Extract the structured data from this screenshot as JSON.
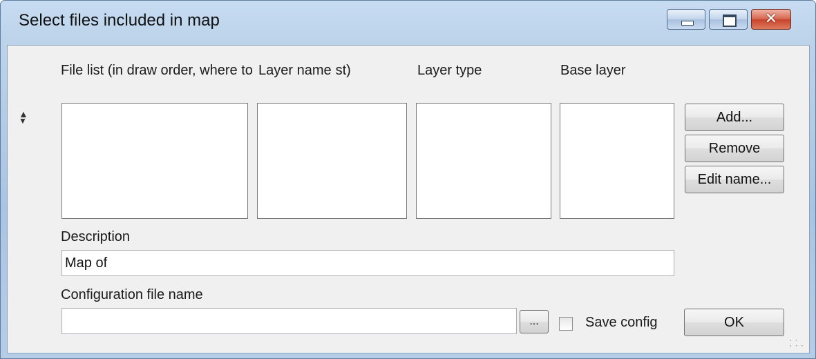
{
  "window": {
    "title": "Select files included in map",
    "controls": {
      "minimize": "minimize",
      "maximize": "maximize",
      "close": "close"
    }
  },
  "columns": {
    "file_list": "File list (in draw order, where to",
    "layer_name": "Layer name",
    "layer_name_tail": "st)",
    "layer_type": "Layer type",
    "base_layer": "Base layer"
  },
  "buttons": {
    "add": "Add...",
    "remove": "Remove",
    "edit_name": "Edit name...",
    "ok": "OK",
    "browse": "..."
  },
  "move": {
    "up": "▲",
    "down": "▼"
  },
  "description": {
    "label": "Description",
    "value": "Map of"
  },
  "config": {
    "label": "Configuration file name",
    "value": "",
    "save_label": "Save config",
    "save_checked": false
  },
  "icons": [
    "minimize-icon",
    "maximize-icon",
    "close-icon",
    "move-up-icon",
    "move-down-icon",
    "resize-grip-icon"
  ],
  "colors": {
    "title_bar": "#b9d1ea",
    "close_button": "#c8432a",
    "client": "#f0f0f0"
  }
}
